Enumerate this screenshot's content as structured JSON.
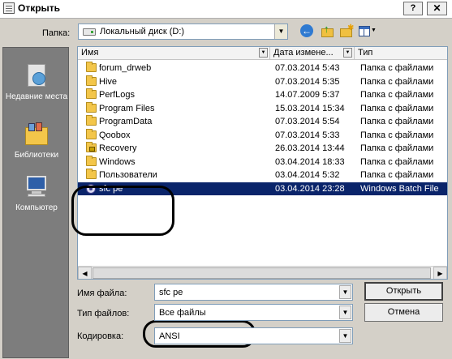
{
  "window": {
    "title": "Открыть",
    "help_label": "?",
    "close_label": "✕"
  },
  "toolbar": {
    "folder_label": "Папка:",
    "folder_value": "Локальный диск (D:)",
    "back_icon": "back-arrow-icon",
    "up_icon": "up-folder-icon",
    "new_folder_icon": "new-folder-icon",
    "view_menu_icon": "view-menu-icon"
  },
  "places": [
    {
      "label": "Недавние места",
      "icon": "recent-places-icon"
    },
    {
      "label": "Библиотеки",
      "icon": "libraries-icon"
    },
    {
      "label": "Компьютер",
      "icon": "computer-icon"
    }
  ],
  "columns": {
    "name": "Имя",
    "date": "Дата измене...",
    "type": "Тип"
  },
  "files": [
    {
      "name": "forum_drweb",
      "date": "07.03.2014 5:43",
      "type": "Папка с файлами",
      "icon": "folder-icon"
    },
    {
      "name": "Hive",
      "date": "07.03.2014 5:35",
      "type": "Папка с файлами",
      "icon": "folder-icon"
    },
    {
      "name": "PerfLogs",
      "date": "14.07.2009 5:37",
      "type": "Папка с файлами",
      "icon": "folder-icon"
    },
    {
      "name": "Program Files",
      "date": "15.03.2014 15:34",
      "type": "Папка с файлами",
      "icon": "folder-icon"
    },
    {
      "name": "ProgramData",
      "date": "07.03.2014 5:54",
      "type": "Папка с файлами",
      "icon": "folder-icon"
    },
    {
      "name": "Qoobox",
      "date": "07.03.2014 5:33",
      "type": "Папка с файлами",
      "icon": "folder-icon"
    },
    {
      "name": "Recovery",
      "date": "26.03.2014 13:44",
      "type": "Папка с файлами",
      "icon": "locked-folder-icon"
    },
    {
      "name": "Windows",
      "date": "03.04.2014 18:33",
      "type": "Папка с файлами",
      "icon": "folder-icon"
    },
    {
      "name": "Пользователи",
      "date": "03.04.2014 5:32",
      "type": "Папка с файлами",
      "icon": "folder-icon"
    },
    {
      "name": "sfc pe",
      "date": "03.04.2014 23:28",
      "type": "Windows Batch File",
      "icon": "batch-file-icon",
      "selected": true
    }
  ],
  "form": {
    "filename_label": "Имя файла:",
    "filename_value": "sfc pe",
    "filetype_label": "Тип файлов:",
    "filetype_value": "Все файлы",
    "encoding_label": "Кодировка:",
    "encoding_value": "ANSI",
    "open_label": "Открыть",
    "cancel_label": "Отмена"
  }
}
